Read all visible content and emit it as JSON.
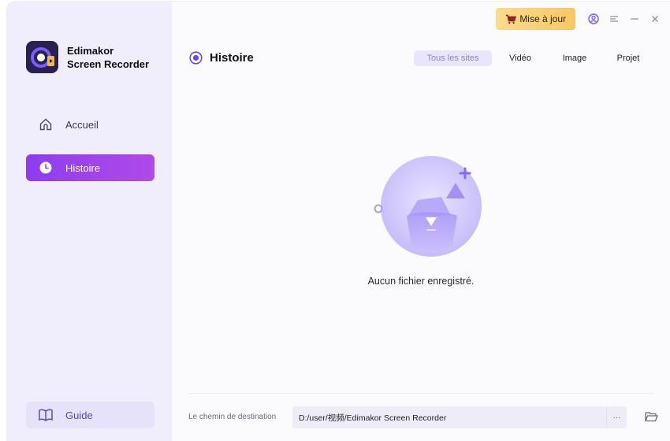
{
  "app": {
    "name_line1": "Edimakor",
    "name_line2": "Screen Recorder"
  },
  "sidebar": {
    "items": [
      {
        "label": "Accueil",
        "icon": "home-icon",
        "active": false
      },
      {
        "label": "Histoire",
        "icon": "clock-icon",
        "active": true
      }
    ],
    "guide_label": "Guide"
  },
  "topbar": {
    "update_label": "Mise à jour"
  },
  "main": {
    "title": "Histoire",
    "tabs": [
      {
        "label": "Tous les sites",
        "active": true
      },
      {
        "label": "Vidéo",
        "active": false
      },
      {
        "label": "Image",
        "active": false
      },
      {
        "label": "Projet",
        "active": false
      }
    ],
    "empty_message": "Aucun fichier enregistré."
  },
  "destination": {
    "label": "Le chemin de destination",
    "path": "D:/user/视频/Edimakor Screen Recorder",
    "more_label": "···"
  },
  "colors": {
    "accent": "#9a43ec",
    "update_bg": "#f9d47a",
    "sidebar_bg": "#f0eefc"
  }
}
